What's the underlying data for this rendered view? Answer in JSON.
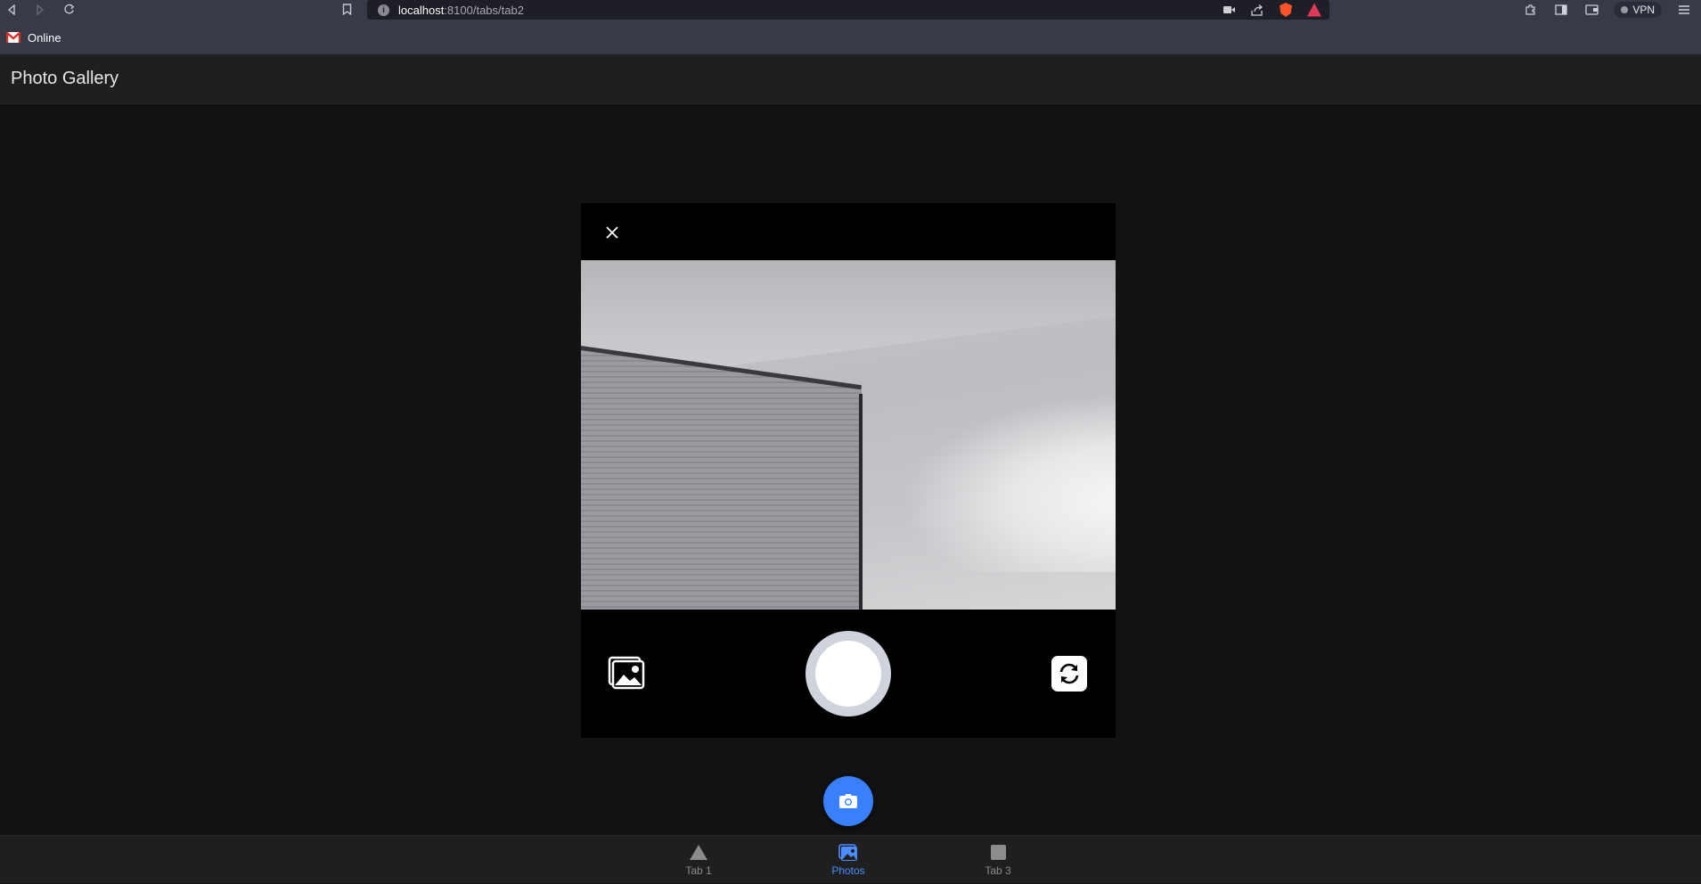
{
  "browser": {
    "url_host": "localhost",
    "url_rest": ":8100/tabs/tab2",
    "info_glyph": "i",
    "vpn_label": "VPN",
    "bookmarks": [
      {
        "label": "Online"
      }
    ]
  },
  "app": {
    "title": "Photo Gallery"
  },
  "camera_modal": {
    "close_icon": "close-icon",
    "gallery_icon": "photo-library-icon",
    "shutter_icon": "shutter-button",
    "flip_icon": "flip-camera-icon"
  },
  "fab": {
    "icon": "camera-icon",
    "color": "#3880ff"
  },
  "tabs": [
    {
      "label": "Tab 1",
      "icon": "triangle-icon",
      "active": false
    },
    {
      "label": "Photos",
      "icon": "images-icon",
      "active": true
    },
    {
      "label": "Tab 3",
      "icon": "square-icon",
      "active": false
    }
  ],
  "colors": {
    "accent": "#3880ff",
    "active_tab": "#4d8dff",
    "inactive_tab": "#8c8c8c"
  }
}
